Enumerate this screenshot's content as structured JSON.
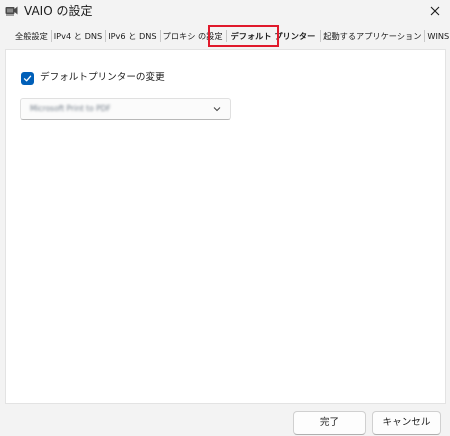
{
  "window": {
    "title": "VAIO の設定",
    "close_symbol": "✕"
  },
  "tabs": [
    {
      "label": "全般設定",
      "active": false
    },
    {
      "label": "IPv4 と DNS",
      "active": false
    },
    {
      "label": "IPv6 と DNS",
      "active": false
    },
    {
      "label": "プロキシ の設定",
      "active": false
    },
    {
      "label": "デフォルト プリンター",
      "active": true
    },
    {
      "label": "起動するアプリケーション",
      "active": false
    },
    {
      "label": "WINS",
      "active": false
    }
  ],
  "printer": {
    "checkbox_label": "デフォルトプリンターの変更",
    "checked": true,
    "selected_printer": "Microsoft Print to PDF"
  },
  "buttons": {
    "ok_label": "完了",
    "cancel_label": "キャンセル"
  },
  "colors": {
    "accent": "#005fb8",
    "highlight": "#e0192b",
    "background": "#f3f3f3",
    "panel": "#ffffff"
  },
  "icons": {
    "app": "vaio-settings-icon",
    "close": "close-icon",
    "check": "checkmark-icon",
    "dropdown": "chevron-down-icon"
  }
}
